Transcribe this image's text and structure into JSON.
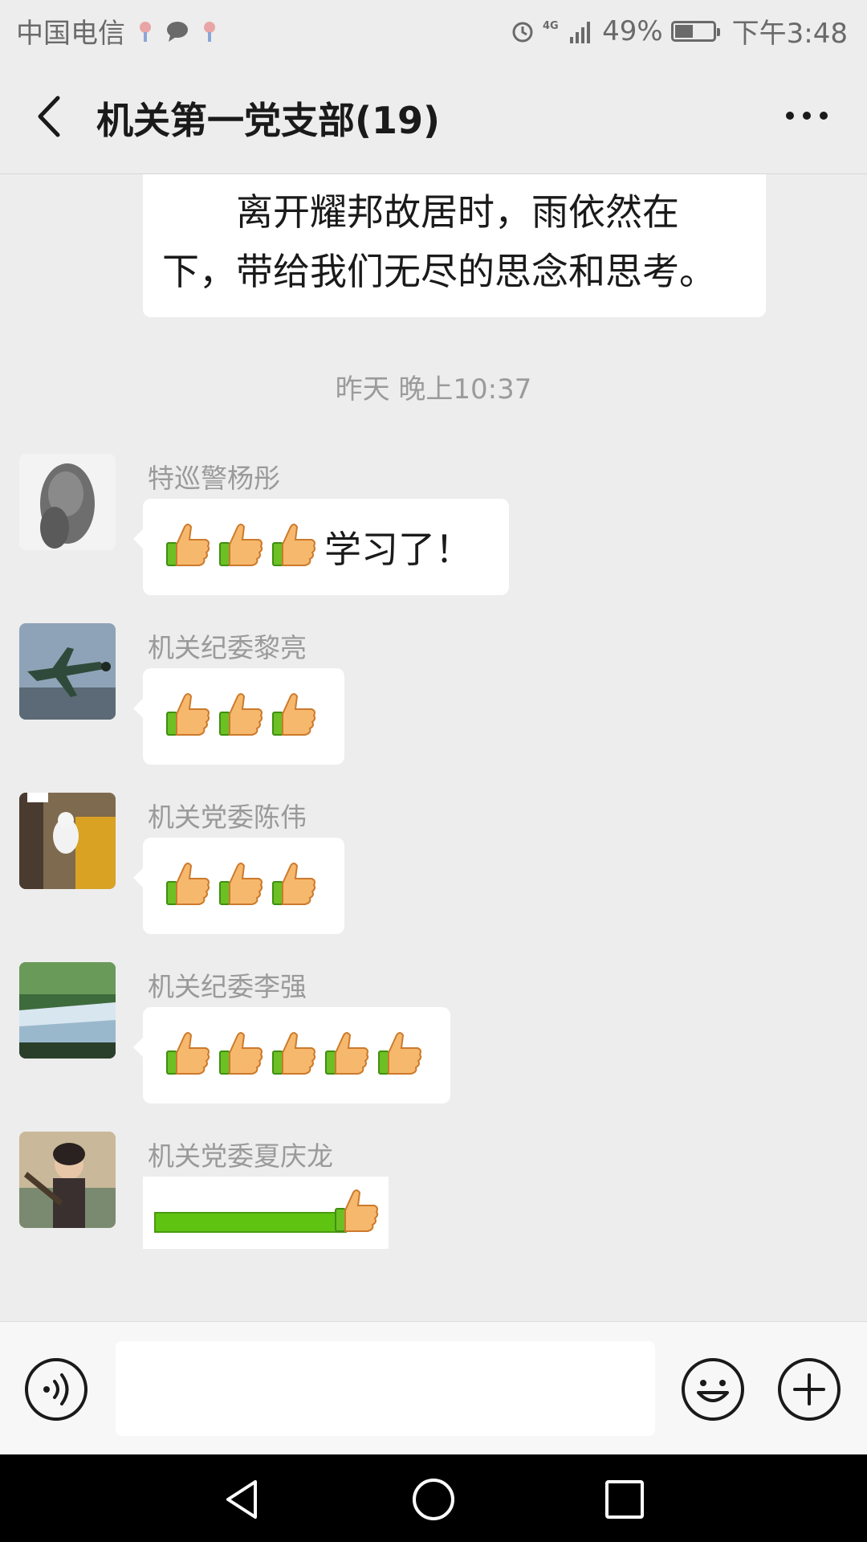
{
  "status_bar": {
    "carrier": "中国电信",
    "network": "4G",
    "battery_percent": "49%",
    "battery_level": 0.49,
    "time": "下午3:48"
  },
  "header": {
    "title": "机关第一党支部(19)"
  },
  "chat": {
    "previous_message": {
      "line1": "离开耀邦故居时，雨依然在",
      "line2": "下，带给我们无尽的思念和思考。"
    },
    "timestamp": "昨天 晚上10:37",
    "messages": [
      {
        "sender": "特巡警杨彤",
        "thumbs": 3,
        "text": "学习了！"
      },
      {
        "sender": "机关纪委黎亮",
        "thumbs": 3,
        "text": ""
      },
      {
        "sender": "机关党委陈伟",
        "thumbs": 3,
        "text": ""
      },
      {
        "sender": "机关纪委李强",
        "thumbs": 5,
        "text": ""
      },
      {
        "sender": "机关党委夏庆龙",
        "sticker": "progress-bar-thumbs-up"
      }
    ]
  },
  "input_bar": {
    "placeholder": ""
  },
  "colors": {
    "background": "#ededed",
    "bubble": "#ffffff",
    "sender_name": "#9a9a9a",
    "progress_green": "#5fc312"
  }
}
